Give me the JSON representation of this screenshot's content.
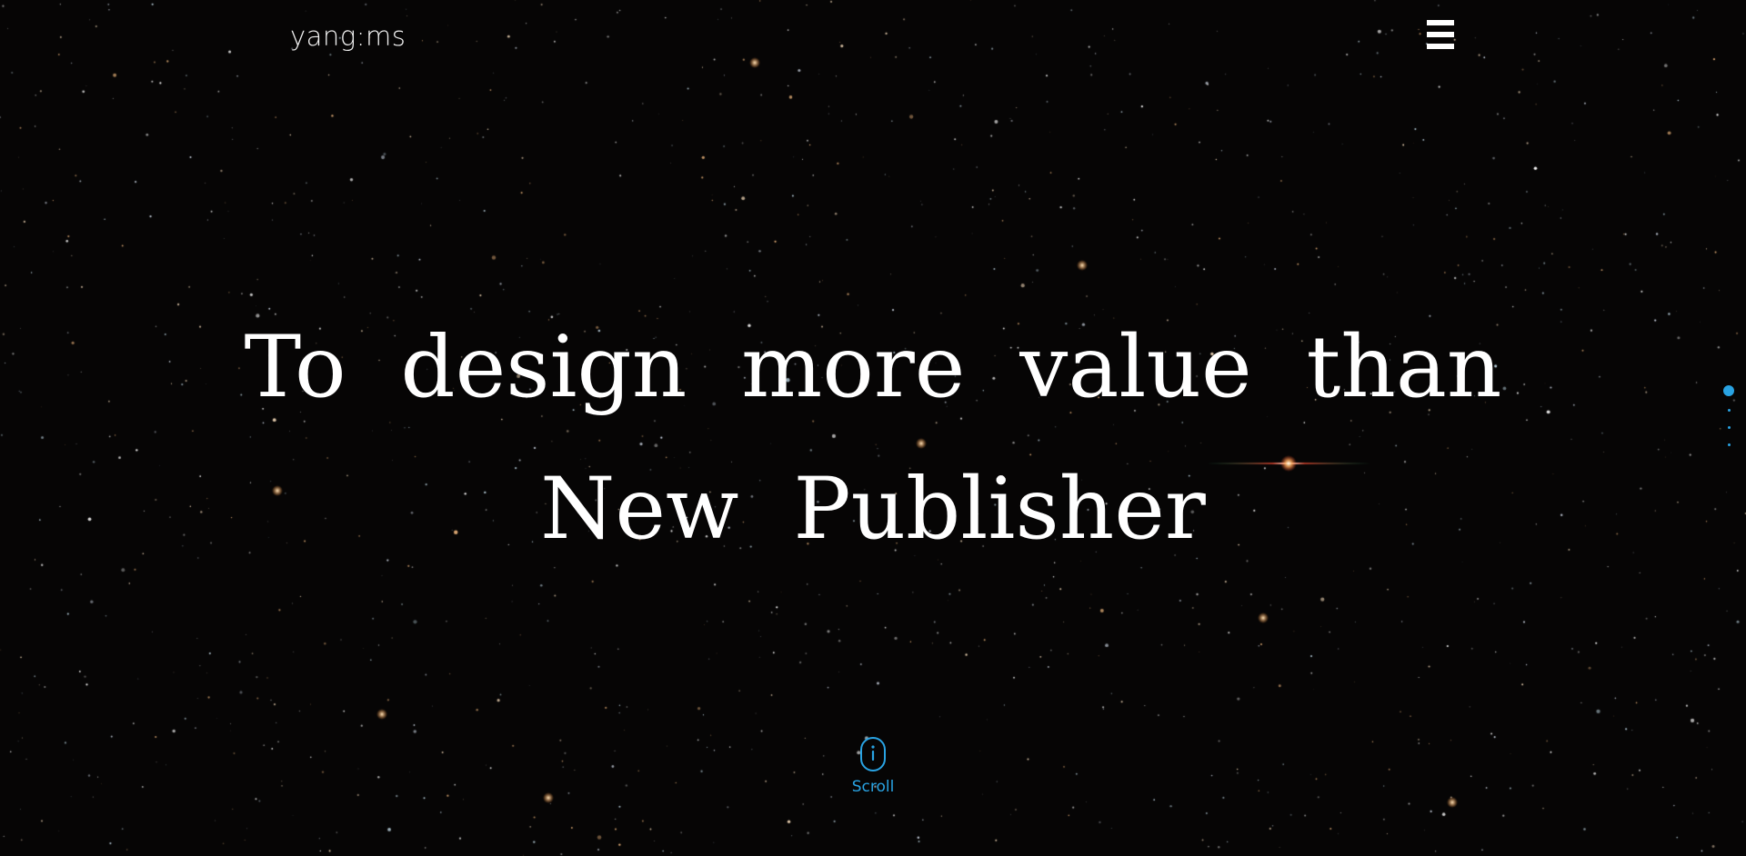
{
  "header": {
    "logo_text": "yang:ms",
    "menu_icon": "hamburger-menu-icon"
  },
  "hero": {
    "line1": "To design more value than",
    "line2": "New Publisher"
  },
  "page_nav": {
    "total_sections": 4,
    "active_section": 1
  },
  "scroll": {
    "label": "Scroll",
    "icon": "mouse-scroll-icon"
  },
  "colors": {
    "background": "#060505",
    "accent": "#29a3e3",
    "text": "#ffffff"
  }
}
